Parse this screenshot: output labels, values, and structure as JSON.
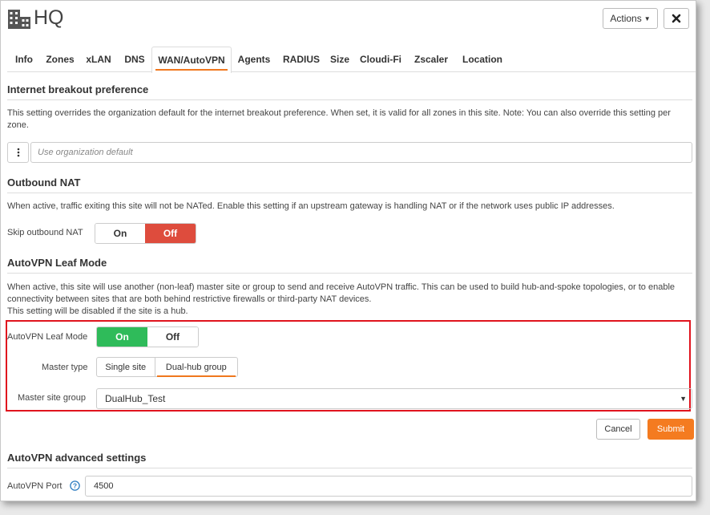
{
  "header": {
    "title": "HQ",
    "actions_label": "Actions"
  },
  "tabs": [
    {
      "label": "Info"
    },
    {
      "label": "Zones"
    },
    {
      "label": "xLAN"
    },
    {
      "label": "DNS"
    },
    {
      "label": "WAN/AutoVPN",
      "active": true
    },
    {
      "label": "Agents"
    },
    {
      "label": "RADIUS"
    },
    {
      "label": "Size"
    },
    {
      "label": "Cloudi-Fi"
    },
    {
      "label": "Zscaler"
    },
    {
      "label": "Location"
    }
  ],
  "internet_breakout": {
    "title": "Internet breakout preference",
    "description": "This setting overrides the organization default for the internet breakout preference. When set, it is valid for all zones in this site. Note: You can also override this setting per zone.",
    "placeholder": "Use organization default"
  },
  "outbound_nat": {
    "title": "Outbound NAT",
    "description": "When active, traffic exiting this site will not be NATed. Enable this setting if an upstream gateway is handling NAT or if the network uses public IP addresses.",
    "label": "Skip outbound NAT",
    "on_label": "On",
    "off_label": "Off",
    "selected": "Off"
  },
  "leaf_mode": {
    "title": "AutoVPN Leaf Mode",
    "description_line1": "When active, this site will use another (non-leaf) master site or group to send and receive AutoVPN traffic. This can be used to build hub-and-spoke topologies, or to enable connectivity between sites that are both behind restrictive firewalls or third-party NAT devices.",
    "description_line2": "This setting will be disabled if the site is a hub.",
    "label": "AutoVPN Leaf Mode",
    "on_label": "On",
    "off_label": "Off",
    "selected": "On",
    "master_type_label": "Master type",
    "master_type_options": [
      "Single site",
      "Dual-hub group"
    ],
    "master_type_selected": "Dual-hub group",
    "master_group_label": "Master site group",
    "master_group_value": "DualHub_Test"
  },
  "buttons": {
    "cancel": "Cancel",
    "submit": "Submit"
  },
  "advanced": {
    "title": "AutoVPN advanced settings",
    "port_label": "AutoVPN Port",
    "port_value": "4500"
  },
  "colors": {
    "accent": "#f47b20",
    "on_green": "#2fbb5a",
    "off_red": "#de4c3d",
    "highlight": "#e0141e"
  }
}
